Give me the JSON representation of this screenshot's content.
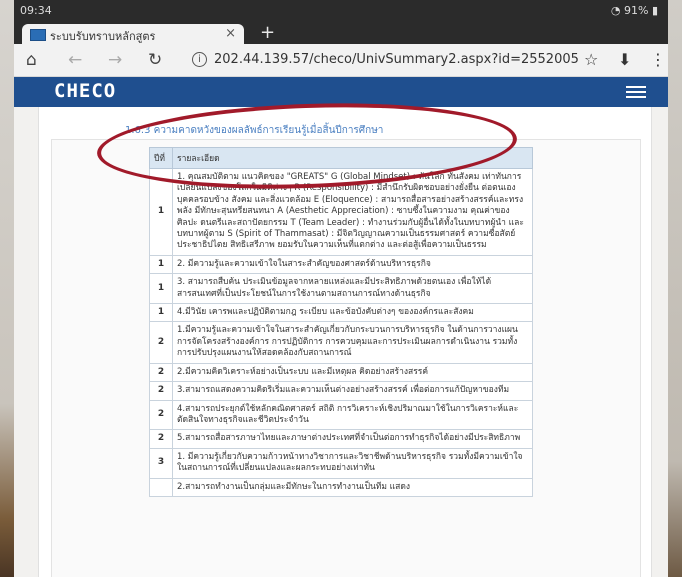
{
  "status": {
    "time": "09:34",
    "battery": "91%"
  },
  "tab": {
    "title": "ระบบรับทราบหลักสูตร",
    "close": "×",
    "new": "+"
  },
  "addressbar": {
    "url": "202.44.139.57/checo/UnivSummary2.aspx?id=2552005"
  },
  "site": {
    "logo": "CHECO"
  },
  "section": {
    "title": "1.6.3 ความคาดหวังของผลลัพธ์การเรียนรู้เมื่อสิ้นปีการศึกษา"
  },
  "table": {
    "headers": [
      "ปีที่",
      "รายละเอียด"
    ],
    "rows": [
      {
        "year": "1",
        "text": "1. คุณสมบัติตาม แนวคิดของ \"GREATS\" G (Global Mindset) : ทันโลก ทันสังคม เท่าทันการเปลี่ยนแปลงของโลกในมิติต่างๆ R (Responsibility) : มีสำนึกรับผิดชอบอย่างยั่งยืน ต่อตนเอง บุคคลรอบข้าง สังคม และสิ่งแวดล้อม E (Eloquence) : สามารถสื่อสารอย่างสร้างสรรค์และทรงพลัง มีทักษะสุนทรียสนทนา A (Aesthetic Appreciation) : ซาบซึ้งในความงาม คุณค่าของศิลปะ ดนตรีและสถาปัตยกรรม T (Team Leader) : ทำงานร่วมกับผู้อื่นได้ทั้งในบทบาทผู้นำ และบทบาทผู้ตาม S (Spirit of Thammasat) : มีจิตวิญญาณความเป็นธรรมศาสตร์ ความซื่อสัตย์ ประชาธิปไตย สิทธิเสรีภาพ ยอมรับในความเห็นที่แตกต่าง และต่อสู้เพื่อความเป็นธรรม"
      },
      {
        "year": "1",
        "text": "2. มีความรู้และความเข้าใจในสาระสำคัญของศาสตร์ด้านบริหารธุรกิจ"
      },
      {
        "year": "1",
        "text": "3. สามารถสืบค้น ประเมินข้อมูลจากหลายแหล่งและมีประสิทธิภาพด้วยตนเอง เพื่อให้ได้สารสนเทศที่เป็นประโยชน์ในการใช้งานตามสถานการณ์ทางด้านธุรกิจ"
      },
      {
        "year": "1",
        "text": "4.มีวินัย เคารพและปฏิบัติตามกฎ ระเบียบ และข้อบังคับต่างๆ ขององค์กรและสังคม"
      },
      {
        "year": "2",
        "text": "1.มีความรู้และความเข้าใจในสาระสำคัญเกี่ยวกับกระบวนการบริหารธุรกิจ ในด้านการวางแผน การจัดโครงสร้างองค์การ การปฏิบัติการ การควบคุมและการประเมินผลการดำเนินงาน รวมทั้งการปรับปรุงแผนงานให้สอดคล้องกับสถานการณ์"
      },
      {
        "year": "2",
        "text": "2.มีความคิดวิเคราะห์อย่างเป็นระบบ และมีเหตุผล คิดอย่างสร้างสรรค์"
      },
      {
        "year": "2",
        "text": "3.สามารถแสดงความคิดริเริ่มและความเห็นต่างอย่างสร้างสรรค์ เพื่อต่อการแก้ปัญหาของทีม"
      },
      {
        "year": "2",
        "text": "4.สามารถประยุกต์ใช้หลักคณิตศาสตร์ สถิติ การวิเคราะห์เชิงปริมาณมาใช้ในการวิเคราะห์และตัดสินใจทางธุรกิจและชีวิตประจำวัน"
      },
      {
        "year": "2",
        "text": "5.สามารถสื่อสารภาษาไทยและภาษาต่างประเทศที่จำเป็นต่อการทำธุรกิจได้อย่างมีประสิทธิภาพ"
      },
      {
        "year": "3",
        "text": "1. มีความรู้เกี่ยวกับความก้าวหน้าทางวิชาการและวิชาชีพด้านบริหารธุรกิจ รวมทั้งมีความเข้าใจในสถานการณ์ที่เปลี่ยนแปลงและผลกระทบอย่างเท่าทัน"
      },
      {
        "year": "",
        "text": "2.สามารถทำงานเป็นกลุ่มและมีทักษะในการทำงานเป็นทีม แสดง"
      }
    ]
  }
}
